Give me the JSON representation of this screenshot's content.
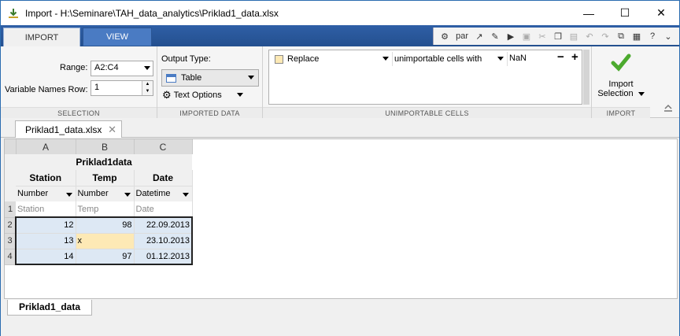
{
  "window": {
    "title": "Import - H:\\Seminare\\TAH_data_analytics\\Priklad1_data.xlsx",
    "minimize": "—",
    "maximize": "☐",
    "close": "✕"
  },
  "toolstrip": {
    "tabs": [
      {
        "label": "IMPORT"
      },
      {
        "label": "VIEW"
      }
    ],
    "quick_access": {
      "par_label": "par"
    }
  },
  "selection": {
    "range_label": "Range:",
    "range_value": "A2:C4",
    "varnames_label": "Variable Names Row:",
    "varnames_value": "1",
    "section_label": "SELECTION"
  },
  "imported_data": {
    "output_type_label": "Output Type:",
    "output_type_value": "Table",
    "text_options_label": "Text Options",
    "section_label": "IMPORTED DATA"
  },
  "unimportable": {
    "action_value": "Replace",
    "rule_value": "unimportable cells with",
    "replacement_value": "NaN",
    "minus": "−",
    "plus": "+",
    "section_label": "UNIMPORTABLE CELLS"
  },
  "import": {
    "button_line1": "Import",
    "button_line2": "Selection",
    "section_label": "IMPORT"
  },
  "file_tab": {
    "label": "Priklad1_data.xlsx"
  },
  "sheet": {
    "columns": [
      "A",
      "B",
      "C"
    ],
    "table_name": "Priklad1data",
    "var_names": [
      "Station",
      "Temp",
      "Date"
    ],
    "var_types": [
      "Number",
      "Number",
      "Datetime"
    ],
    "rows": [
      {
        "row_num": "1",
        "cells": [
          "Station",
          "Temp",
          "Date"
        ]
      },
      {
        "row_num": "2",
        "cells": [
          "12",
          "98",
          "22.09.2013"
        ]
      },
      {
        "row_num": "3",
        "cells": [
          "13",
          "x",
          "23.10.2013"
        ]
      },
      {
        "row_num": "4",
        "cells": [
          "14",
          "97",
          "01.12.2013"
        ]
      }
    ]
  },
  "sheet_tab": {
    "label": "Priklad1_data"
  },
  "colors": {
    "toolstrip_blue": "#2f5fa6",
    "selection_fill": "#dde8f4",
    "unimportable_fill": "#fde9b5"
  }
}
